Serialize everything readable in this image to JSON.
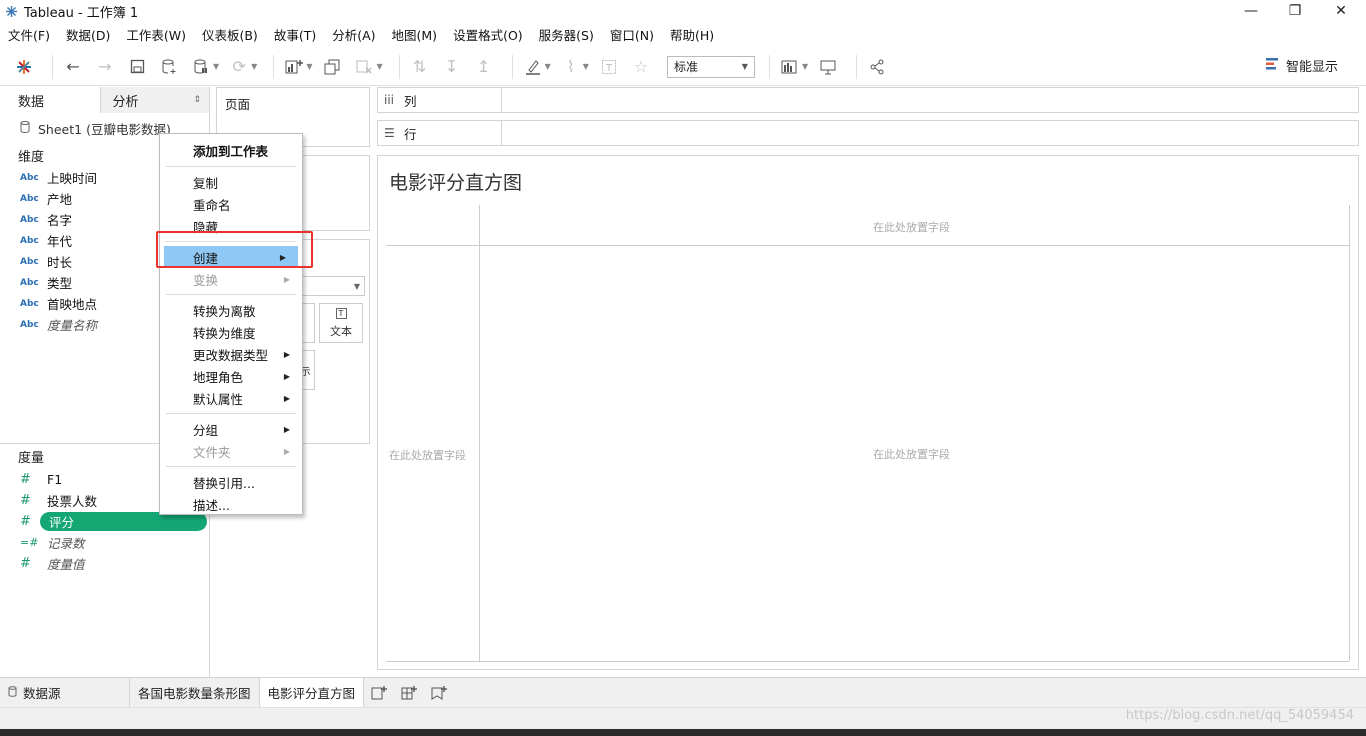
{
  "window": {
    "title": "Tableau - 工作簿 1",
    "minimize": "—",
    "restore": "❐",
    "close": "✕"
  },
  "menubar": [
    "文件(F)",
    "数据(D)",
    "工作表(W)",
    "仪表板(B)",
    "故事(T)",
    "分析(A)",
    "地图(M)",
    "设置格式(O)",
    "服务器(S)",
    "窗口(N)",
    "帮助(H)"
  ],
  "toolbar": {
    "fit_value": "标准",
    "smart_show": "智能显示"
  },
  "left_pane": {
    "tab_data": "数据",
    "tab_analysis": "分析",
    "datasource": "Sheet1 (豆瓣电影数据)",
    "dimensions_label": "维度",
    "dimensions": [
      {
        "type": "Abc",
        "name": "上映时间"
      },
      {
        "type": "Abc",
        "name": "产地"
      },
      {
        "type": "Abc",
        "name": "名字"
      },
      {
        "type": "Abc",
        "name": "年代"
      },
      {
        "type": "Abc",
        "name": "时长"
      },
      {
        "type": "Abc",
        "name": "类型"
      },
      {
        "type": "Abc",
        "name": "首映地点"
      },
      {
        "type": "Abc",
        "name": "度量名称"
      }
    ],
    "measures_label": "度量",
    "measures": [
      {
        "type": "#",
        "name": "F1"
      },
      {
        "type": "#",
        "name": "投票人数"
      },
      {
        "type": "#",
        "name": "评分"
      },
      {
        "type": "=#",
        "name": "记录数"
      },
      {
        "type": "#",
        "name": "度量值"
      }
    ]
  },
  "shelves": {
    "pages": "页面",
    "columns": "列",
    "rows": "行",
    "mark_text": "文本",
    "mark_partial": "示"
  },
  "viz": {
    "title": "电影评分直方图",
    "drop_field": "在此处放置字段"
  },
  "context_menu": {
    "add_to_sheet": "添加到工作表",
    "copy": "复制",
    "rename": "重命名",
    "hide": "隐藏",
    "create": "创建",
    "transform": "变换",
    "convert_discrete": "转换为离散",
    "convert_dimension": "转换为维度",
    "change_type": "更改数据类型",
    "geo_role": "地理角色",
    "default_props": "默认属性",
    "group": "分组",
    "folder": "文件夹",
    "replace_ref": "替换引用...",
    "describe": "描述..."
  },
  "tabs": {
    "datasource": "数据源",
    "sheet1": "各国电影数量条形图",
    "sheet2": "电影评分直方图"
  },
  "watermark": "https://blog.csdn.net/qq_54059454"
}
